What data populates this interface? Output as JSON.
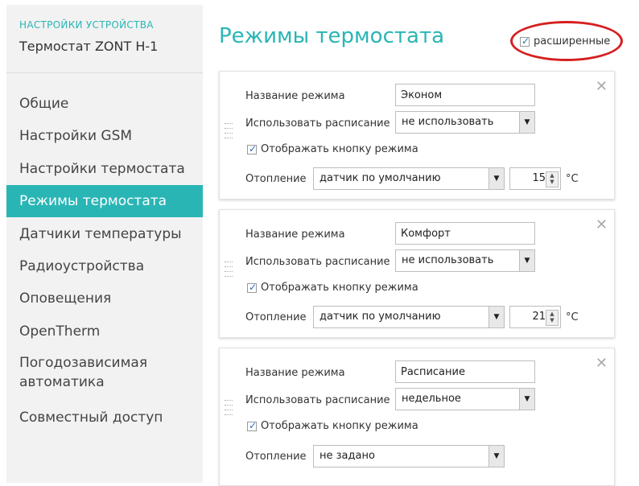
{
  "sidebar": {
    "subtitle": "НАСТРОЙКИ УСТРОЙСТВА",
    "title": "Термостат ZONT H-1",
    "items": [
      {
        "label": "Общие"
      },
      {
        "label": "Настройки GSM"
      },
      {
        "label": "Настройки термостата"
      },
      {
        "label": "Режимы термостата",
        "active": true
      },
      {
        "label": "Датчики температуры"
      },
      {
        "label": "Радиоустройства"
      },
      {
        "label": "Оповещения"
      },
      {
        "label": "OpenTherm"
      },
      {
        "label_line1": "Погодозависимая",
        "label_line2": "автоматика"
      },
      {
        "label": "Совместный доступ"
      }
    ]
  },
  "main": {
    "title": "Режимы термостата",
    "advanced": {
      "label": "расширенные",
      "checked": true
    },
    "labels": {
      "mode_name": "Название режима",
      "use_schedule": "Использовать расписание",
      "show_button": "Отображать кнопку режима",
      "heating": "Отопление",
      "unit": "°C"
    },
    "modes": [
      {
        "name": "Эконом",
        "schedule": "не использовать",
        "show_button": true,
        "heating_sensor": "датчик по умолчанию",
        "temperature": "15"
      },
      {
        "name": "Комфорт",
        "schedule": "не использовать",
        "show_button": true,
        "heating_sensor": "датчик по умолчанию",
        "temperature": "21"
      },
      {
        "name": "Расписание",
        "schedule": "недельное",
        "show_button": true,
        "heating_sensor": "не задано"
      }
    ]
  },
  "colors": {
    "accent": "#2ab5b5",
    "highlight_circle": "#d62020"
  },
  "icons": {
    "close": "close-icon",
    "dropdown": "chevron-down-icon",
    "drag": "drag-handle-icon",
    "check": "check-icon"
  }
}
